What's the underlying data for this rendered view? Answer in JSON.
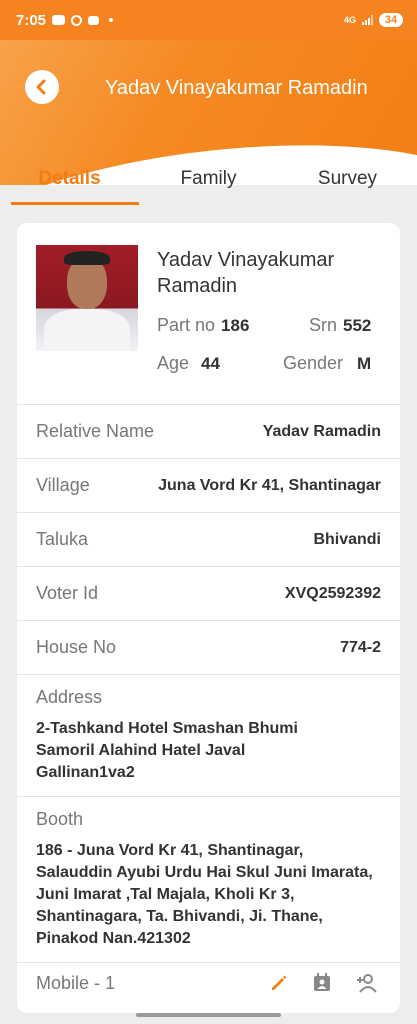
{
  "status_bar": {
    "time": "7:05",
    "network": "4G",
    "battery": "34"
  },
  "header": {
    "title": "Yadav Vinayakumar Ramadin",
    "back_icon": "back-arrow-icon"
  },
  "tabs": [
    {
      "label": "Details",
      "active": true
    },
    {
      "label": "Family",
      "active": false
    },
    {
      "label": "Survey",
      "active": false
    }
  ],
  "profile": {
    "name": "Yadav Vinayakumar Ramadin",
    "part_no_label": "Part no",
    "part_no": "186",
    "srn_label": "Srn",
    "srn": "552",
    "age_label": "Age",
    "age": "44",
    "gender_label": "Gender",
    "gender": "M"
  },
  "details": [
    {
      "label": "Relative Name",
      "value": "Yadav Ramadin"
    },
    {
      "label": "Village",
      "value": "Juna Vord Kr 41, Shantinagar"
    },
    {
      "label": "Taluka",
      "value": "Bhivandi"
    },
    {
      "label": "Voter Id",
      "value": "XVQ2592392"
    },
    {
      "label": "House No",
      "value": "774-2"
    }
  ],
  "address": {
    "label": "Address",
    "value": "2-Tashkand Hotel Smashan Bhumi Samoril Alahind Hatel Javal Gallinan1va2"
  },
  "booth": {
    "label": "Booth",
    "value": "186 - Juna Vord Kr 41, Shantinagar, Salauddin Ayubi Urdu Hai Skul Juni Imarata, Juni Imarat ,Tal Majala, Kholi Kr 3, Shantinagara, Ta. Bhivandi, Ji. Thane, Pinakod Nan.421302"
  },
  "mobile": {
    "label": "Mobile - 1"
  },
  "colors": {
    "accent": "#f5831f",
    "tab_active": "#f07d14"
  }
}
